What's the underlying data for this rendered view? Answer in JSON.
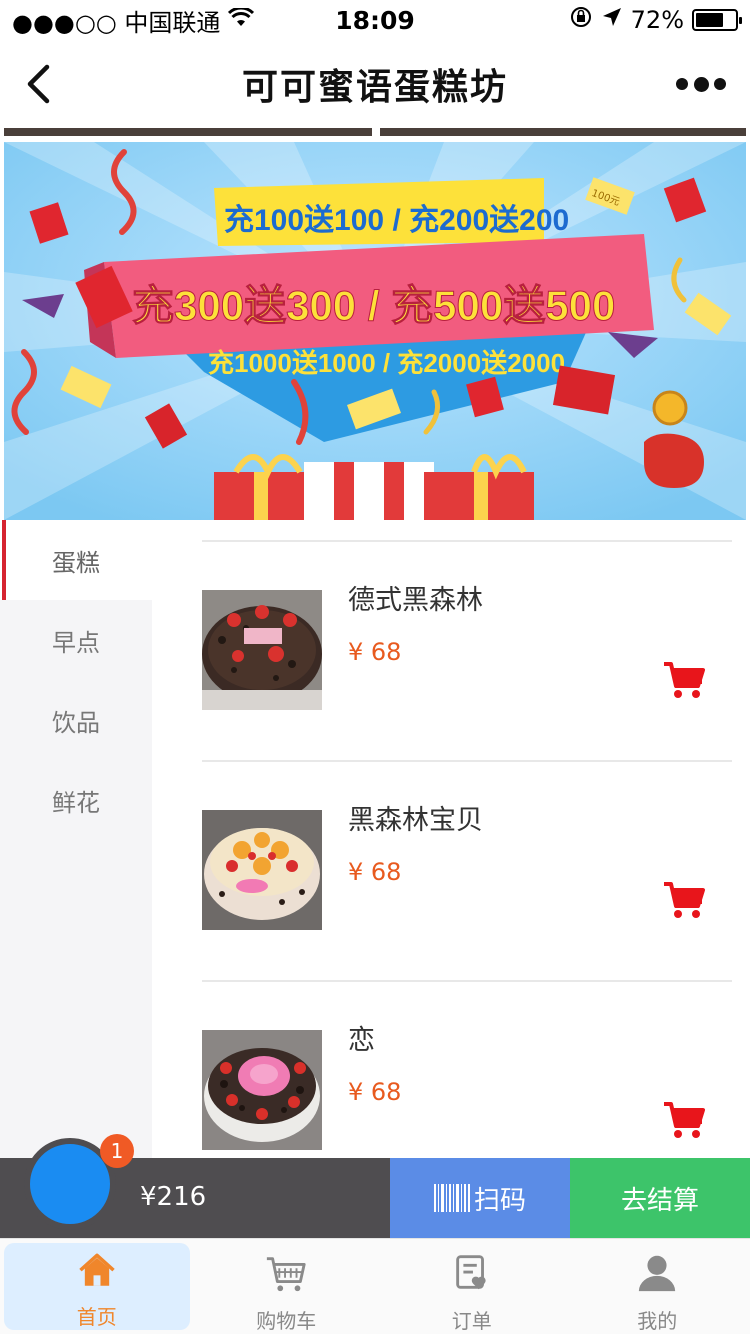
{
  "status_bar": {
    "carrier": "●●●○○ 中国联通",
    "time": "18:09",
    "battery": "72%",
    "battery_level": 0.72
  },
  "nav": {
    "title": "可可蜜语蛋糕坊"
  },
  "banner": {
    "line1": "充100送100 / 充200送200",
    "line2": "充300送300 / 充500送500",
    "line3": "充1000送1000 / 充2000送2000",
    "tag": "100元"
  },
  "sidebar": {
    "items": [
      {
        "label": "蛋糕"
      },
      {
        "label": "早点"
      },
      {
        "label": "饮品"
      },
      {
        "label": "鲜花"
      }
    ]
  },
  "products": [
    {
      "name": "德式黑森林",
      "price": "¥ 68"
    },
    {
      "name": "黑森林宝贝",
      "price": "¥ 68"
    },
    {
      "name": "恋",
      "price": "¥ 68"
    }
  ],
  "cart_bar": {
    "total": "¥216",
    "badge": "1",
    "scan_label": "扫码",
    "checkout_label": "去结算"
  },
  "tab_bar": {
    "items": [
      {
        "label": "首页",
        "icon": "home-icon"
      },
      {
        "label": "购物车",
        "icon": "cart-icon"
      },
      {
        "label": "订单",
        "icon": "order-icon"
      },
      {
        "label": "我的",
        "icon": "user-icon"
      }
    ]
  },
  "colors": {
    "accent_red": "#d62430",
    "price_orange": "#e85a1f",
    "scan_blue": "#5b8ce6",
    "checkout_green": "#3dc46a",
    "cart_blue": "#1a8cf2"
  }
}
